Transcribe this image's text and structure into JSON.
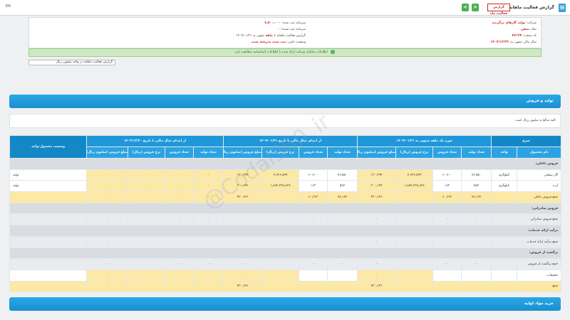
{
  "topbar": {
    "title": "گزارش فعالیت ماهانه",
    "badge": "گزارش فعالیت ماه",
    "nav_prev": "<",
    "nav_next": ">",
    "lang": "EN"
  },
  "info": {
    "company_label": "شرکت:",
    "company_value": "تولید گازهای برگزیده",
    "symbol_label": "نماد:",
    "symbol_value": "شفن",
    "code_label": "کد صنعت:",
    "code_value": "۴۴۱۳۴",
    "capital_label": "سرمایه ثبت شده:",
    "capital_value": "۷,۵۰۰,۰۰۰",
    "unreg_capital_label": "سرمایه ثبت نشده:",
    "unreg_capital_value": "۰",
    "report_label": "گزارش فعالیت ماهانه",
    "report_period": "۱ ماهه",
    "report_end": "منتهی به ۱۴۰۴/۰۱/۳۱",
    "fiscal_label": "سال مالی منتهی به:",
    "fiscal_value": "۱۴۰۴/۱۲/۲۹",
    "status_label": "وضعیت ناشر:",
    "status_value": "ثبت شده پذیرفته شده"
  },
  "notice": "اطلاعات سالیانه شرکت ارائه شده با اطلاعات اساسنامه مطابقت دارد",
  "select_label": "گزارش فعالیت ماهانه در واحد میلیون ریال",
  "sections": {
    "production": "تولید و فروش",
    "raw_materials": "خرید مواد اولیه"
  },
  "unit_note": "کلیه مبالغ به میلیون ریال است",
  "table": {
    "group_headers": {
      "description": "شرح",
      "period_1": "دوره یک ماهه منتهی به ۱۴۰۴/۰۱/۳۱",
      "period_2": "از ابتدای سال مالی تا تاریخ ۱۴۰۴/۰۱/۳۱",
      "period_3": "از ابتدای سال مالی تا تاریخ ۱۴۰۳/۱۲/۳۰",
      "status": "وضعیت محصول-واحد"
    },
    "columns": [
      "نام محصول",
      "واحد",
      "تعداد تولید",
      "تعداد فروش",
      "نرخ فروش (ریال)",
      "مبلغ فروش (میلیون ریال)",
      "تعداد تولید",
      "تعداد فروش",
      "نرخ فروش (ریال)",
      "مبلغ فروش (میلیون ریال)",
      "تعداد تولید",
      "تعداد فروش",
      "نرخ فروش (ریال)",
      "مبلغ فروش (میلیون ریال)"
    ],
    "rows": [
      {
        "kind": "group",
        "cells": [
          "فروش داخلی:"
        ]
      },
      {
        "kind": "data",
        "cells": [
          "گاز صنعتی",
          "کیلوگرم",
          "۷۶,۵۵۰",
          "۶۰,۲۰۰",
          "۲,۶۲۶,۵۹۹",
          "۱۳۰,۴۹۴",
          "۷۶,۵۵۰",
          "۶۰,۲۰۰",
          "۲,۶۲۶,۵۹۹",
          "۱۳۰,۴۹۴",
          "۰",
          "۰",
          "۰",
          "۰",
          "تولید"
        ]
      },
      {
        "kind": "data",
        "cells": [
          "ازت",
          "کیلوگرم",
          "۵۷۲",
          "۱۶۳",
          "۱,۸۷۲,۲۳۸,۸۳۸",
          "۳۰۰,۱۴۲",
          "۵۷۲",
          "۱۶۳",
          "۱,۸۷۲,۲۳۸,۸۳۸",
          "۳۰۰,۱۴۲",
          "۰",
          "۰",
          "۰",
          "۰",
          "تولید"
        ]
      },
      {
        "kind": "yellow",
        "cells": [
          "جمع فروش داخلی",
          "",
          "۷۷,۱۲۲",
          "۶۰,۳۶۳",
          "",
          "۴۳۰,۶۳۶",
          "۷۷,۱۲۲",
          "۶۰,۳۶۳",
          "",
          "۴۳۰,۶۳۶",
          "۰",
          "۰",
          "",
          "۰",
          ""
        ]
      },
      {
        "kind": "group",
        "cells": [
          "فروش صادراتی:"
        ]
      },
      {
        "kind": "gray",
        "cells": [
          "جمع فروش صادراتی",
          "",
          "۰",
          "۰",
          "",
          "۰",
          "۰",
          "۰",
          "",
          "۰",
          "۰",
          "۰",
          "",
          "۰",
          ""
        ]
      },
      {
        "kind": "group",
        "cells": [
          "درآمد ارائه خدمات:"
        ]
      },
      {
        "kind": "gray",
        "cells": [
          "جمع درآمد ارائه خدمات",
          "",
          "",
          "",
          "",
          "۰",
          "",
          "",
          "",
          "۰",
          "",
          "",
          "",
          "۰",
          ""
        ]
      },
      {
        "kind": "group",
        "cells": [
          "برگشت از فروش:"
        ]
      },
      {
        "kind": "gray",
        "cells": [
          "جمع برگشت از فروش",
          "",
          "۰",
          "۰",
          "",
          "۰",
          "۰",
          "۰",
          "",
          "۰",
          "۰",
          "۰",
          "",
          "۰",
          ""
        ]
      },
      {
        "kind": "data",
        "cells": [
          "تخفیفات",
          "",
          "",
          "",
          "",
          "۰",
          "",
          "",
          "",
          "۰",
          "",
          "",
          "",
          "۰",
          ""
        ]
      },
      {
        "kind": "yellow",
        "cells": [
          "جمع",
          "",
          "",
          "",
          "",
          "۴۳۰,۶۳۶",
          "",
          "",
          "",
          "۴۳۰,۶۳۶",
          "",
          "",
          "",
          "۰",
          ""
        ]
      }
    ]
  },
  "watermark": "@Codal360_ir"
}
